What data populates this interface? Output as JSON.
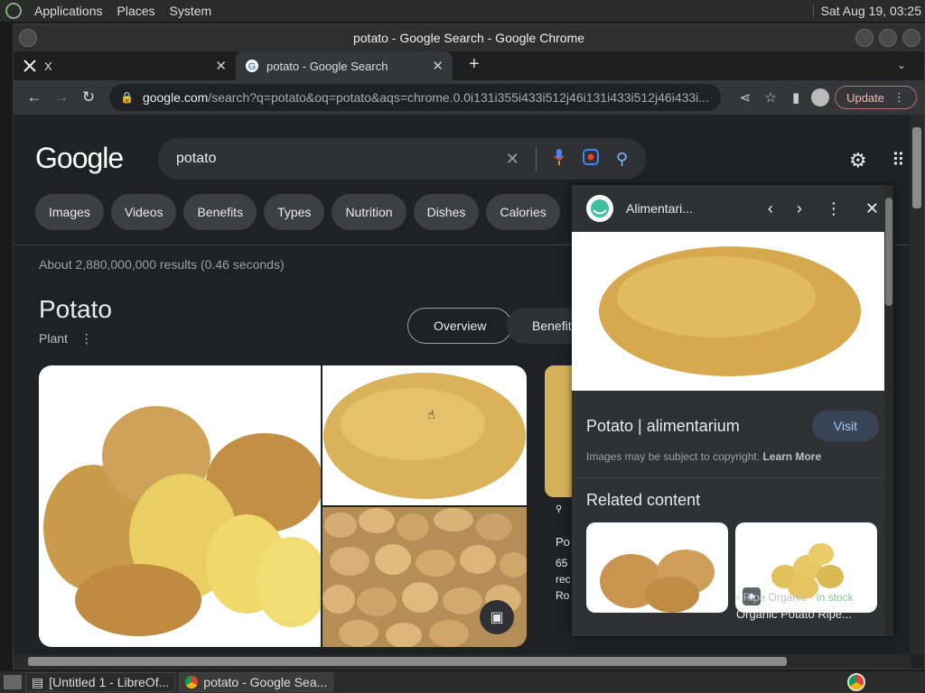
{
  "top_panel": {
    "menus": [
      "Applications",
      "Places",
      "System"
    ],
    "clock": "Sat Aug 19, 03:25"
  },
  "window": {
    "title": "potato - Google Search - Google Chrome"
  },
  "tabs": [
    {
      "label": "X",
      "icon": "x-logo-icon"
    },
    {
      "label": "potato - Google Search",
      "icon": "google-icon"
    }
  ],
  "toolbar": {
    "url_host": "google.com",
    "url_path": "/search?q=potato&oq=potato&aqs=chrome.0.0i131i355i433i512j46i131i433i512j46i433i...",
    "update_label": "Update"
  },
  "search": {
    "logo": "Google",
    "query": "potato"
  },
  "chips": [
    "Images",
    "Videos",
    "Benefits",
    "Types",
    "Nutrition",
    "Dishes",
    "Calories"
  ],
  "results_info": "About 2,880,000,000 results (0.46 seconds)",
  "knowledge_panel": {
    "title": "Potato",
    "subtitle": "Plant",
    "tab_overview": "Overview",
    "tab_benefits": "Benefits"
  },
  "side_snippets": [
    "Po",
    "65",
    "rec",
    "Ro"
  ],
  "image_viewer": {
    "source": "Alimentari...",
    "title": "Potato | alimentarium",
    "visit": "Visit",
    "note": "Images may be subject to copyright.",
    "learn_more": "Learn More",
    "related_heading": "Related content",
    "related_source": "Ripe Organic",
    "related_stock": "In stock",
    "related_name": "Organic Potato Ripe..."
  },
  "taskbar": {
    "items": [
      "[Untitled 1 - LibreOf...",
      "potato - Google Sea..."
    ]
  },
  "colors": {
    "page_bg": "#202124",
    "chip_bg": "#3c4043",
    "accent_blue": "#8ab4f8",
    "stock_green": "#81c995"
  }
}
